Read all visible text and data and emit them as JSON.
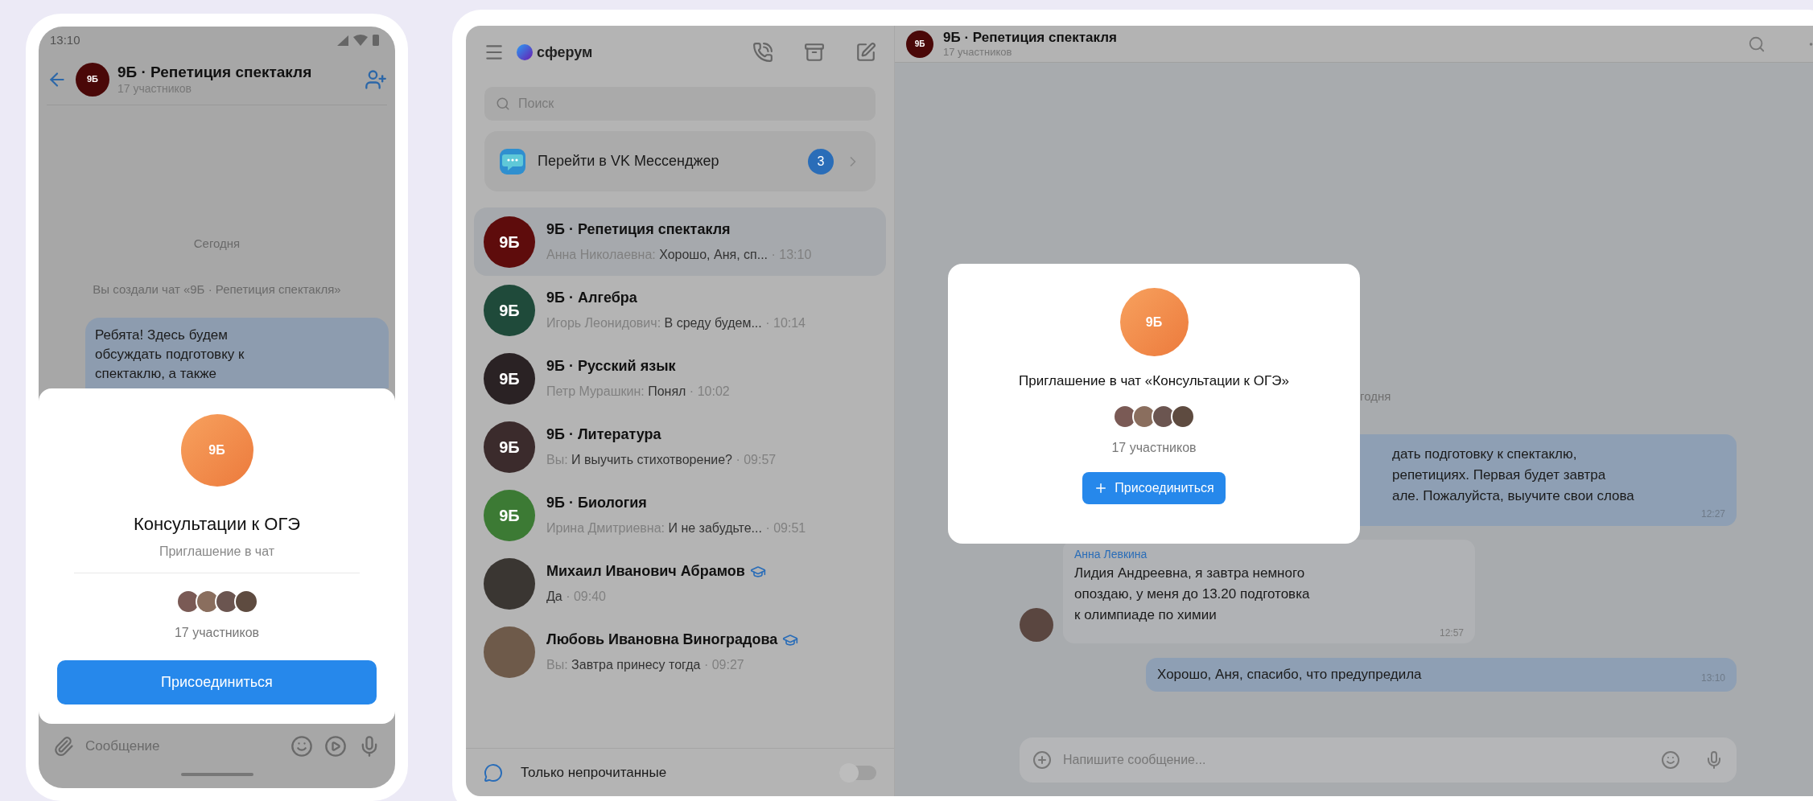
{
  "phone": {
    "status_time": "13:10",
    "header": {
      "avatar": "9Б",
      "title": "9Б · Репетиция спектакля",
      "subtitle": "17 участников"
    },
    "date": "Сегодня",
    "system_message": "Вы создали чат «9Б · Репетиция спектакля»",
    "message_lines": [
      "Ребята! Здесь будем",
      "обсуждать подготовку к",
      "спектаклю, а также"
    ],
    "invite": {
      "avatar": "9Б",
      "title": "Консультации к ОГЭ",
      "subtitle": "Приглашение в чат",
      "count": "17 участников",
      "button": "Присоединиться"
    },
    "composer": {
      "placeholder": "Сообщение"
    }
  },
  "desktop": {
    "sidebar": {
      "logo": "сферум",
      "search": {
        "placeholder": "Поиск"
      },
      "banner": {
        "label": "Перейти в VK Мессенджер",
        "badge": "3"
      },
      "chats": [
        {
          "kind": "group",
          "avatar": "9Б",
          "color": "#5e0c0c",
          "title": "9Б · Репетиция спектакля",
          "teacher_badge": false,
          "sender": "Анна Николаевна:",
          "text": "Хорошо, Аня, сп...",
          "time": "· 13:10",
          "selected": true
        },
        {
          "kind": "group",
          "avatar": "9Б",
          "color": "#1f4a3a",
          "title": "9Б · Алгебра",
          "teacher_badge": false,
          "sender": "Игорь Леонидович:",
          "text": "В среду будем...",
          "time": "· 10:14",
          "selected": false
        },
        {
          "kind": "group",
          "avatar": "9Б",
          "color": "#2a2224",
          "title": "9Б · Русский язык",
          "teacher_badge": false,
          "sender": "Петр Мурашкин:",
          "text": "Понял",
          "time": "· 10:02",
          "selected": false
        },
        {
          "kind": "group",
          "avatar": "9Б",
          "color": "#3b2b2c",
          "title": "9Б · Литература",
          "teacher_badge": false,
          "sender": "Вы:",
          "text": "И выучить стихотворение?",
          "time": "· 09:57",
          "selected": false
        },
        {
          "kind": "group",
          "avatar": "9Б",
          "color": "#3c7a34",
          "title": "9Б · Биология",
          "teacher_badge": false,
          "sender": "Ирина Дмитриевна:",
          "text": "И не забудьте...",
          "time": "· 09:51",
          "selected": false
        },
        {
          "kind": "photo",
          "color": "#3a3632",
          "title": "Михаил Иванович Абрамов",
          "teacher_badge": true,
          "text": "Да",
          "time": "· 09:40",
          "selected": false
        },
        {
          "kind": "photo",
          "color": "#6e5a4a",
          "title": "Любовь Ивановна Виноградова",
          "teacher_badge": true,
          "sender": "Вы:",
          "text": "Завтра принесу тогда",
          "time": "· 09:27",
          "selected": false
        }
      ],
      "unread_filter": {
        "label": "Только непрочитанные",
        "on": false
      }
    },
    "chat": {
      "header": {
        "avatar": "9Б",
        "title": "9Б · Репетиция спектакля",
        "subtitle": "17 участников"
      },
      "date": "годня",
      "messages": [
        {
          "kind": "outgoing",
          "lines": [
            "дать подготовку к спектаклю,",
            "репетициях. Первая будет завтра",
            "але. Пожалуйста, выучите свои слова"
          ],
          "time": "12:27"
        },
        {
          "kind": "incoming",
          "author": "Анна Левкина",
          "lines": [
            "Лидия Андреевна, я завтра немного",
            "опоздаю, у меня до 13.20 подготовка",
            "к олимпиаде по химии"
          ],
          "time": "12:57"
        },
        {
          "kind": "outgoing",
          "lines": [
            "Хорошо, Аня, спасибо, что предупредила"
          ],
          "time": "13:10"
        }
      ],
      "composer": {
        "placeholder": "Напишите сообщение..."
      }
    },
    "invite": {
      "avatar": "9Б",
      "title": "Приглашение в чат «Консультации к ОГЭ»",
      "count": "17 участников",
      "button": "Присоединиться"
    }
  }
}
